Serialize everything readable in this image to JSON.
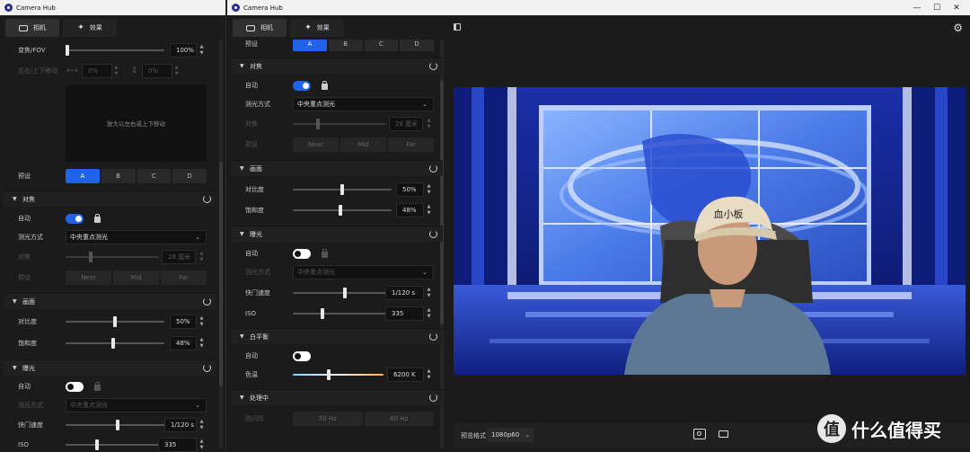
{
  "app": {
    "title": "Camera Hub"
  },
  "window_controls": {
    "minimize": "—",
    "maximize": "☐",
    "close": "✕"
  },
  "tabs": {
    "camera": "相机",
    "effects": "效果"
  },
  "panel1": {
    "zoom_label": "变焦/FOV",
    "zoom_value": "100%",
    "zoom_level": 0.0,
    "pan_label": "左右/上下移动",
    "pan_x": "0%",
    "pan_y": "0%",
    "preview_hint": "放大以左右或上下移动",
    "preset_label": "预设",
    "presets": [
      "A",
      "B",
      "C",
      "D"
    ],
    "focus": {
      "title": "对焦",
      "auto_label": "自动",
      "mode_label": "测光方式",
      "mode_value": "中央重点测光",
      "focus_label": "对焦",
      "focus_value": "28 厘米",
      "preset_label": "预设",
      "presets": [
        "Near",
        "Mid",
        "Far"
      ]
    },
    "picture": {
      "title": "画面",
      "contrast_label": "对比度",
      "contrast_value": "50%",
      "saturation_label": "饱和度",
      "saturation_value": "48%"
    },
    "exposure": {
      "title": "曝光",
      "auto_label": "自动",
      "mode_label": "测光方式",
      "mode_value": "中央重点测光",
      "shutter_label": "快门速度",
      "shutter_value": "1/120 s",
      "iso_label": "ISO",
      "iso_value": "335"
    }
  },
  "panel2": {
    "preset_label": "预设",
    "presets": [
      "A",
      "B",
      "C",
      "D"
    ],
    "focus": {
      "title": "对焦",
      "auto_label": "自动",
      "mode_label": "测光方式",
      "mode_value": "中央重点测光",
      "focus_label": "对焦",
      "focus_value": "28 厘米",
      "preset_label": "预设",
      "presets": [
        "Near",
        "Mid",
        "Far"
      ]
    },
    "picture": {
      "title": "画面",
      "contrast_label": "对比度",
      "contrast_value": "50%",
      "saturation_label": "饱和度",
      "saturation_value": "48%"
    },
    "exposure": {
      "title": "曝光",
      "auto_label": "自动",
      "mode_label": "测光方式",
      "mode_value": "中央重点测光",
      "shutter_label": "快门速度",
      "shutter_value": "1/120 s",
      "iso_label": "ISO",
      "iso_value": "335"
    },
    "white_balance": {
      "title": "白平衡",
      "auto_label": "自动",
      "temp_label": "色温",
      "temp_value": "6200 K"
    },
    "processing": {
      "title": "处理中",
      "antiflicker_label": "防闪烁",
      "options": [
        "50 Hz",
        "60 Hz"
      ]
    }
  },
  "preview": {
    "format_label": "预览格式",
    "format_value": "1080p60",
    "cap_text": "血小板"
  },
  "watermark": {
    "text": "什么值得买",
    "badge": "值"
  },
  "colors": {
    "accent": "#1e63e9",
    "bg": "#1b1b1b",
    "panel": "#202020"
  }
}
